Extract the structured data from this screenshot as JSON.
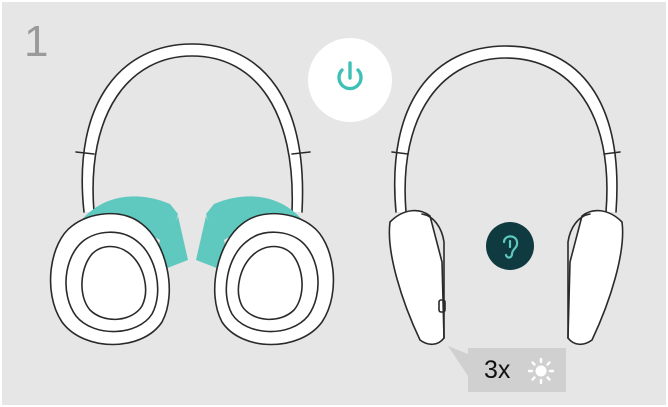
{
  "step": {
    "number": "1"
  },
  "blink_indicator": {
    "count_label": "3x"
  },
  "icons": {
    "power": "power-icon",
    "ear": "ear-icon",
    "led": "led-light-icon",
    "rotate_arrow": "rotate-arrow-icon"
  },
  "colors": {
    "background": "#e6e6e6",
    "accent_teal": "#5fc9c0",
    "badge_dark": "#0f3a3f",
    "callout_box": "#d0d0d0",
    "step_number": "#9a9a9a"
  }
}
